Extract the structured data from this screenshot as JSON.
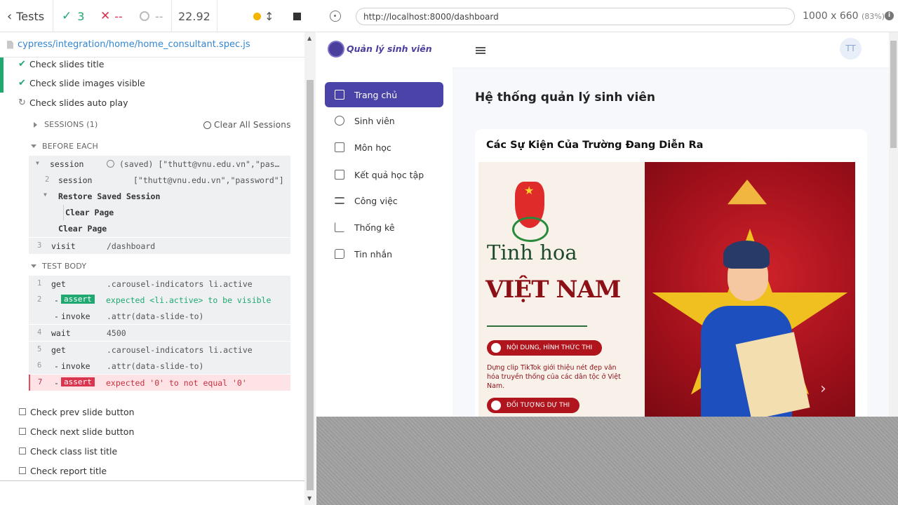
{
  "reporter": {
    "back_label": "Tests",
    "passed_count": "3",
    "failed_count": "--",
    "pending_count": "--",
    "duration": "22.92",
    "spec_path": "cypress/integration/home/home_consultant.spec.js",
    "tests": [
      {
        "label": "Check slides title",
        "state": "passed"
      },
      {
        "label": "Check slide images visible",
        "state": "passed"
      },
      {
        "label": "Check slides auto play",
        "state": "running"
      },
      {
        "label": "Check prev slide button",
        "state": "pending"
      },
      {
        "label": "Check next slide button",
        "state": "pending"
      },
      {
        "label": "Check class list title",
        "state": "pending"
      },
      {
        "label": "Check report title",
        "state": "pending"
      }
    ],
    "sessions_label": "SESSIONS (1)",
    "clear_sessions_label": "Clear All Sessions",
    "before_each_label": "BEFORE EACH",
    "test_body_label": "TEST BODY",
    "before_each_commands": [
      {
        "num": "",
        "name": "session",
        "msg": "(saved) [\"thutt@vnu.edu.vn\",\"pas…"
      },
      {
        "num": "2",
        "name": "session",
        "msg": "[\"thutt@vnu.edu.vn\",\"password\"]"
      },
      {
        "num": "",
        "name": "Restore Saved Session",
        "msg": ""
      },
      {
        "num": "",
        "name": "Clear Page",
        "msg": ""
      },
      {
        "num": "",
        "name": "Clear Page",
        "msg": ""
      },
      {
        "num": "3",
        "name": "visit",
        "msg": "/dashboard"
      }
    ],
    "test_body_commands": [
      {
        "num": "1",
        "name": "get",
        "msg": ".carousel-indicators li.active"
      },
      {
        "num": "2",
        "name": "assert",
        "msg": "expected <li.active> to be visible"
      },
      {
        "num": "",
        "name": "invoke",
        "msg": ".attr(data-slide-to)"
      },
      {
        "num": "4",
        "name": "wait",
        "msg": "4500"
      },
      {
        "num": "5",
        "name": "get",
        "msg": ".carousel-indicators li.active"
      },
      {
        "num": "6",
        "name": "invoke",
        "msg": ".attr(data-slide-to)"
      },
      {
        "num": "7",
        "name": "assert",
        "msg": "expected '0' to not equal '0'"
      }
    ]
  },
  "browser": {
    "url": "http://localhost:8000/dashboard",
    "viewport": "1000 x 660",
    "scale": "(83%)"
  },
  "app": {
    "logo_text": "Quản lý sinh viên",
    "avatar_initials": "TT",
    "nav": [
      {
        "label": "Trang chủ",
        "active": true
      },
      {
        "label": "Sinh viên",
        "active": false
      },
      {
        "label": "Môn học",
        "active": false
      },
      {
        "label": "Kết quả học tập",
        "active": false
      },
      {
        "label": "Công việc",
        "active": false
      },
      {
        "label": "Thống kê",
        "active": false
      },
      {
        "label": "Tin nhắn",
        "active": false
      }
    ],
    "page_title": "Hệ thống quản lý sinh viên",
    "card_title": "Các Sự Kiện Của Trường Đang Diễn Ra",
    "slide": {
      "title_line1": "Tinh hoa",
      "title_line2": "VIỆT NAM",
      "pill1": "NỘI DUNG, HÌNH THỨC THI",
      "desc": "Dựng clip TikTok giới thiệu nét đẹp văn hóa truyền thống của các dân tộc ở Việt Nam.",
      "pill2": "ĐỐI TƯỢNG DỰ THI"
    }
  },
  "colors": {
    "pass": "#1fa971",
    "fail": "#d9354e",
    "nav_active": "#4b44a8",
    "link": "#3386d4"
  }
}
